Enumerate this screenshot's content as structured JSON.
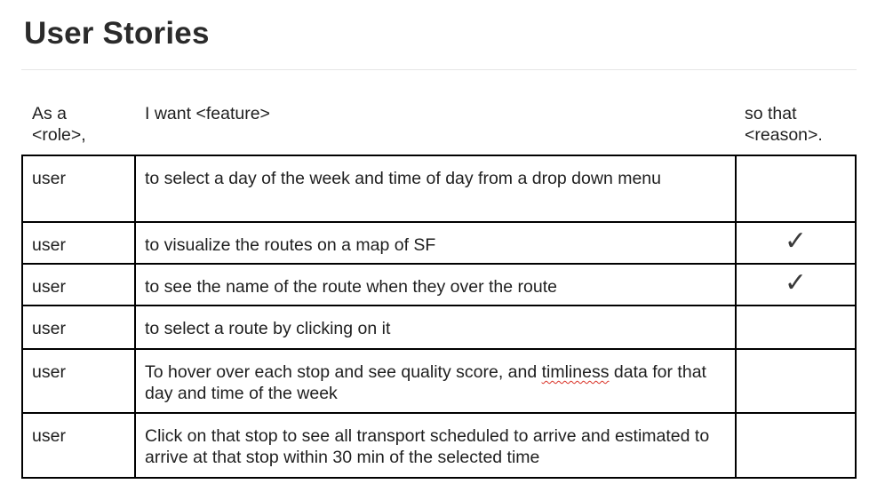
{
  "document": {
    "title": "User Stories"
  },
  "table": {
    "headers": {
      "role": "As a <role>,",
      "feature": "I want <feature>",
      "reason": "so that <reason>."
    },
    "rows": [
      {
        "role": "user",
        "feature": "to select a day of the week and time of day from a drop down menu",
        "reason_check": ""
      },
      {
        "role": "user",
        "feature": "to visualize the routes on a map of SF",
        "reason_check": "✓"
      },
      {
        "role": "user",
        "feature": "to see the name of the route when they over the route",
        "reason_check": "✓"
      },
      {
        "role": "user",
        "feature": "to select a route by clicking on it",
        "reason_check": ""
      },
      {
        "role": "user",
        "feature_before": "To hover over each stop and see quality score, and ",
        "feature_misspelled": "timliness",
        "feature_after": " data for that day and time of the week",
        "reason_check": ""
      },
      {
        "role": "user",
        "feature": "Click on that stop to see all transport scheduled to arrive and estimated to arrive at that stop within 30 min of the selected time",
        "reason_check": ""
      }
    ]
  },
  "icons": {
    "check": "checkmark-icon"
  },
  "colors": {
    "spellcheck_underline": "#d93025",
    "table_border": "#000000"
  }
}
